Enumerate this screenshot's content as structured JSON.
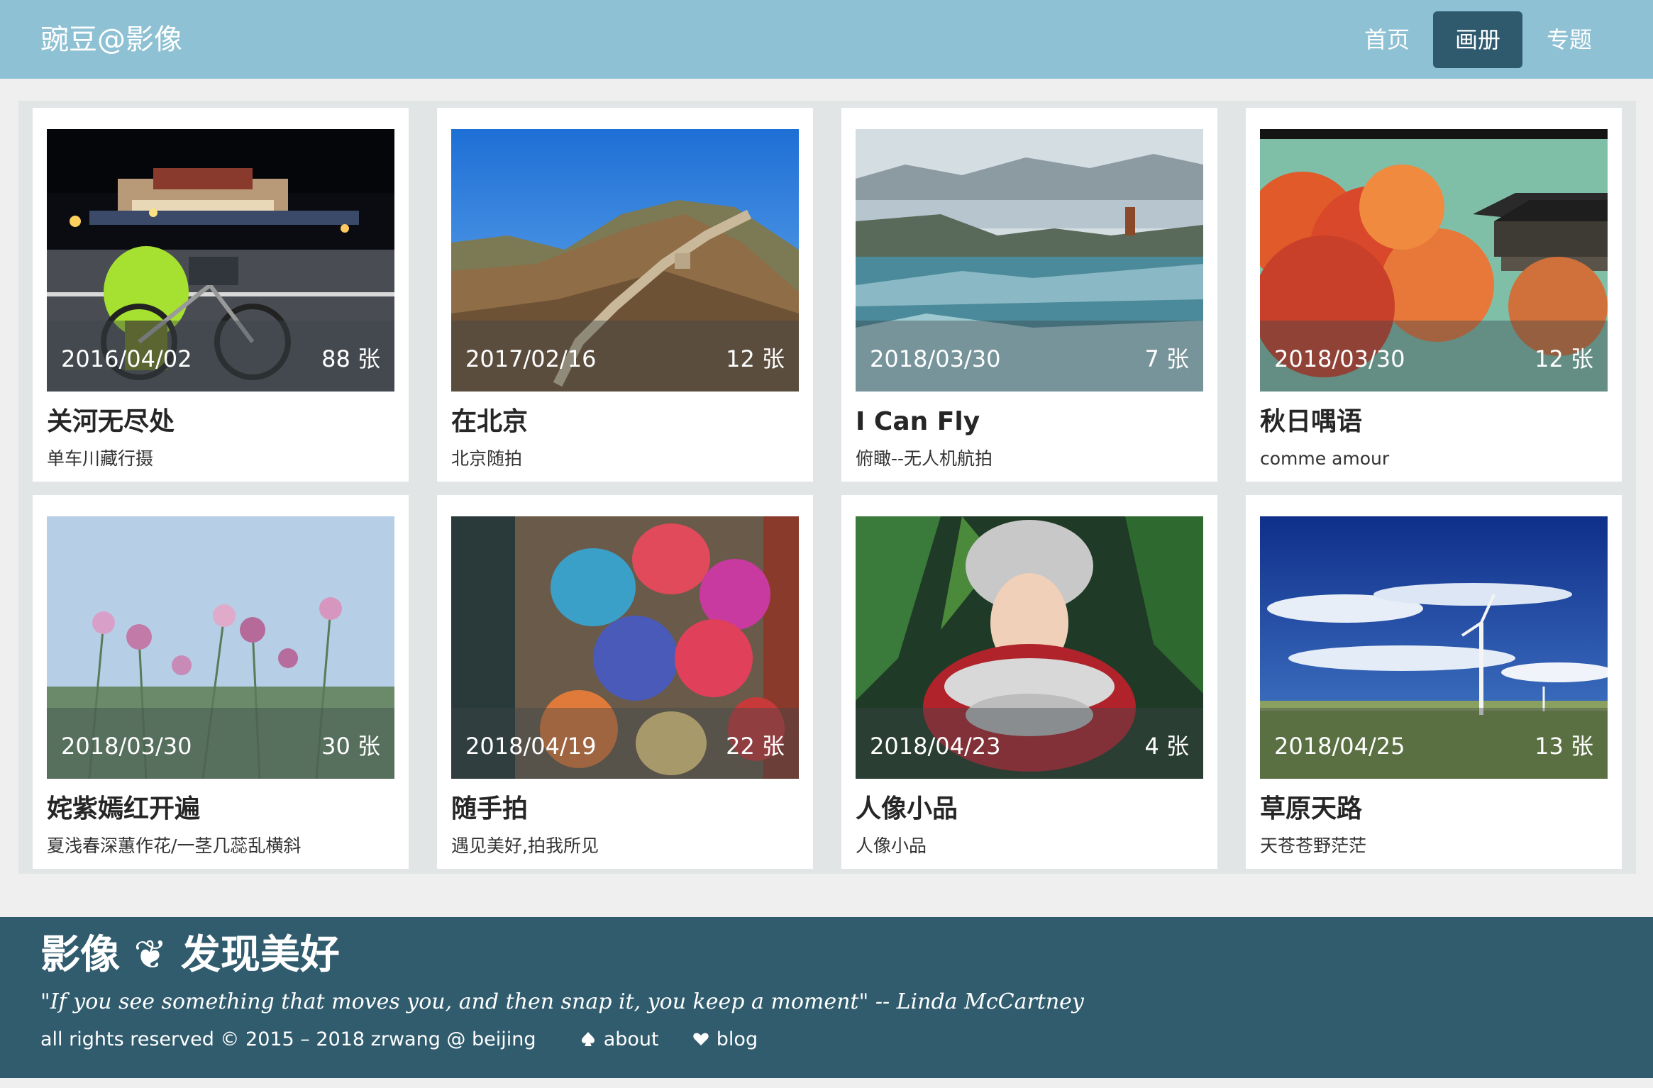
{
  "header": {
    "brand": "豌豆@影像",
    "nav": [
      {
        "label": "首页",
        "active": false
      },
      {
        "label": "画册",
        "active": true
      },
      {
        "label": "专题",
        "active": false
      }
    ]
  },
  "colors": {
    "header_bg": "#8ec1d3",
    "active_nav_bg": "#2f5a6e",
    "footer_bg": "#305c6e",
    "panel_bg": "#e2e5e6",
    "card_bg": "#ffffff"
  },
  "albums": [
    {
      "date": "2016/04/02",
      "count": "88 张",
      "title": "关河无尽处",
      "subtitle": "单车川藏行摄"
    },
    {
      "date": "2017/02/16",
      "count": "12 张",
      "title": "在北京",
      "subtitle": "北京随拍"
    },
    {
      "date": "2018/03/30",
      "count": "7 张",
      "title": "I Can Fly",
      "subtitle": "俯瞰--无人机航拍"
    },
    {
      "date": "2018/03/30",
      "count": "12 张",
      "title": "秋日喁语",
      "subtitle": "comme amour"
    },
    {
      "date": "2018/03/30",
      "count": "30 张",
      "title": "姹紫嫣红开遍",
      "subtitle": "夏浅春深蕙作花/一茎几蕊乱横斜"
    },
    {
      "date": "2018/04/19",
      "count": "22 张",
      "title": "随手拍",
      "subtitle": "遇见美好,拍我所见"
    },
    {
      "date": "2018/04/23",
      "count": "4 张",
      "title": "人像小品",
      "subtitle": "人像小品"
    },
    {
      "date": "2018/04/25",
      "count": "13 张",
      "title": "草原天路",
      "subtitle": "天苍苍野茫茫"
    }
  ],
  "footer": {
    "tagline": "影像 ❦ 发现美好",
    "quote": "\"If you see something that moves you, and then snap it, you keep a moment\" -- Linda McCartney",
    "copyright": "all rights reserved © 2015 – 2018 zrwang @ beijing",
    "about_label": "about",
    "blog_label": "blog",
    "about_icon": "spade-icon",
    "blog_icon": "heart-icon"
  }
}
